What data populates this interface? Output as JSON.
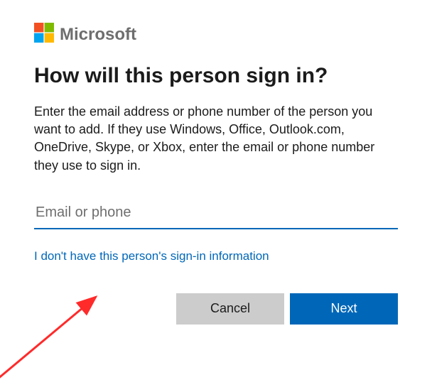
{
  "brand": {
    "name": "Microsoft"
  },
  "heading": "How will this person sign in?",
  "description": "Enter the email address or phone number of the person you want to add. If they use Windows, Office, Outlook.com, OneDrive, Skype, or Xbox, enter the email or phone number they use to sign in.",
  "input": {
    "placeholder": "Email or phone",
    "value": ""
  },
  "link_no_info": "I don't have this person's sign-in information",
  "buttons": {
    "cancel": "Cancel",
    "next": "Next"
  },
  "colors": {
    "accent": "#0067b8",
    "cancel_bg": "#cccccc"
  }
}
